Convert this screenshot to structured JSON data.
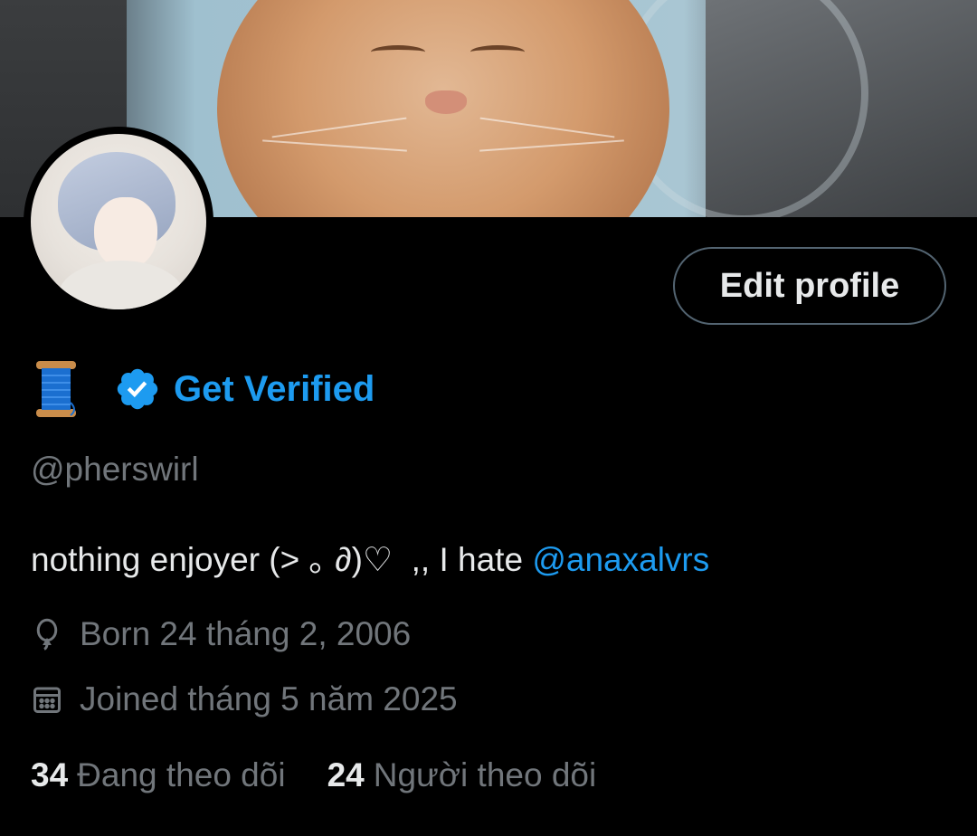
{
  "banner": {
    "image": "orange-cat-closeup-photo"
  },
  "avatar": {
    "image": "anime-character-silver-hair"
  },
  "header": {
    "edit_profile_label": "Edit profile"
  },
  "profile": {
    "name_emoji": "spool-of-thread-icon",
    "get_verified_label": "Get Verified",
    "handle": "@pherswirl",
    "bio_text": "nothing enjoyer (˃ ｡ ∂)♡  ,, I hate ",
    "bio_mention": "@anaxalvrs",
    "born": "Born 24 tháng 2, 2006",
    "joined": "Joined tháng 5 năm 2025"
  },
  "stats": {
    "following_count": "34",
    "following_label": "Đang theo dõi",
    "followers_count": "24",
    "followers_label": "Người theo dõi"
  },
  "colors": {
    "accent": "#1d9bf0",
    "muted": "#71767b",
    "text": "#e7e9ea",
    "background": "#000000"
  }
}
